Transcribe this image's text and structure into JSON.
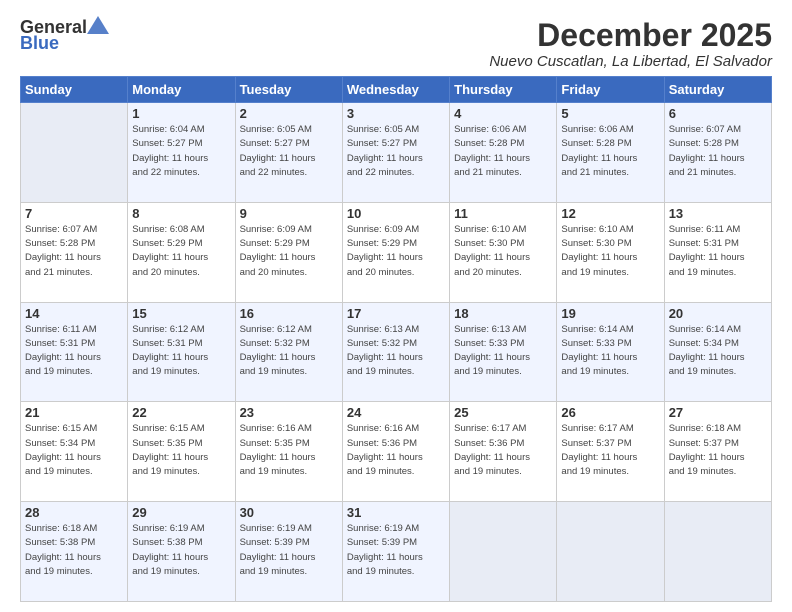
{
  "header": {
    "logo_general": "General",
    "logo_blue": "Blue",
    "month_title": "December 2025",
    "location": "Nuevo Cuscatlan, La Libertad, El Salvador"
  },
  "weekdays": [
    "Sunday",
    "Monday",
    "Tuesday",
    "Wednesday",
    "Thursday",
    "Friday",
    "Saturday"
  ],
  "weeks": [
    [
      {
        "day": "",
        "info": ""
      },
      {
        "day": "1",
        "info": "Sunrise: 6:04 AM\nSunset: 5:27 PM\nDaylight: 11 hours\nand 22 minutes."
      },
      {
        "day": "2",
        "info": "Sunrise: 6:05 AM\nSunset: 5:27 PM\nDaylight: 11 hours\nand 22 minutes."
      },
      {
        "day": "3",
        "info": "Sunrise: 6:05 AM\nSunset: 5:27 PM\nDaylight: 11 hours\nand 22 minutes."
      },
      {
        "day": "4",
        "info": "Sunrise: 6:06 AM\nSunset: 5:28 PM\nDaylight: 11 hours\nand 21 minutes."
      },
      {
        "day": "5",
        "info": "Sunrise: 6:06 AM\nSunset: 5:28 PM\nDaylight: 11 hours\nand 21 minutes."
      },
      {
        "day": "6",
        "info": "Sunrise: 6:07 AM\nSunset: 5:28 PM\nDaylight: 11 hours\nand 21 minutes."
      }
    ],
    [
      {
        "day": "7",
        "info": "Sunrise: 6:07 AM\nSunset: 5:28 PM\nDaylight: 11 hours\nand 21 minutes."
      },
      {
        "day": "8",
        "info": "Sunrise: 6:08 AM\nSunset: 5:29 PM\nDaylight: 11 hours\nand 20 minutes."
      },
      {
        "day": "9",
        "info": "Sunrise: 6:09 AM\nSunset: 5:29 PM\nDaylight: 11 hours\nand 20 minutes."
      },
      {
        "day": "10",
        "info": "Sunrise: 6:09 AM\nSunset: 5:29 PM\nDaylight: 11 hours\nand 20 minutes."
      },
      {
        "day": "11",
        "info": "Sunrise: 6:10 AM\nSunset: 5:30 PM\nDaylight: 11 hours\nand 20 minutes."
      },
      {
        "day": "12",
        "info": "Sunrise: 6:10 AM\nSunset: 5:30 PM\nDaylight: 11 hours\nand 19 minutes."
      },
      {
        "day": "13",
        "info": "Sunrise: 6:11 AM\nSunset: 5:31 PM\nDaylight: 11 hours\nand 19 minutes."
      }
    ],
    [
      {
        "day": "14",
        "info": "Sunrise: 6:11 AM\nSunset: 5:31 PM\nDaylight: 11 hours\nand 19 minutes."
      },
      {
        "day": "15",
        "info": "Sunrise: 6:12 AM\nSunset: 5:31 PM\nDaylight: 11 hours\nand 19 minutes."
      },
      {
        "day": "16",
        "info": "Sunrise: 6:12 AM\nSunset: 5:32 PM\nDaylight: 11 hours\nand 19 minutes."
      },
      {
        "day": "17",
        "info": "Sunrise: 6:13 AM\nSunset: 5:32 PM\nDaylight: 11 hours\nand 19 minutes."
      },
      {
        "day": "18",
        "info": "Sunrise: 6:13 AM\nSunset: 5:33 PM\nDaylight: 11 hours\nand 19 minutes."
      },
      {
        "day": "19",
        "info": "Sunrise: 6:14 AM\nSunset: 5:33 PM\nDaylight: 11 hours\nand 19 minutes."
      },
      {
        "day": "20",
        "info": "Sunrise: 6:14 AM\nSunset: 5:34 PM\nDaylight: 11 hours\nand 19 minutes."
      }
    ],
    [
      {
        "day": "21",
        "info": "Sunrise: 6:15 AM\nSunset: 5:34 PM\nDaylight: 11 hours\nand 19 minutes."
      },
      {
        "day": "22",
        "info": "Sunrise: 6:15 AM\nSunset: 5:35 PM\nDaylight: 11 hours\nand 19 minutes."
      },
      {
        "day": "23",
        "info": "Sunrise: 6:16 AM\nSunset: 5:35 PM\nDaylight: 11 hours\nand 19 minutes."
      },
      {
        "day": "24",
        "info": "Sunrise: 6:16 AM\nSunset: 5:36 PM\nDaylight: 11 hours\nand 19 minutes."
      },
      {
        "day": "25",
        "info": "Sunrise: 6:17 AM\nSunset: 5:36 PM\nDaylight: 11 hours\nand 19 minutes."
      },
      {
        "day": "26",
        "info": "Sunrise: 6:17 AM\nSunset: 5:37 PM\nDaylight: 11 hours\nand 19 minutes."
      },
      {
        "day": "27",
        "info": "Sunrise: 6:18 AM\nSunset: 5:37 PM\nDaylight: 11 hours\nand 19 minutes."
      }
    ],
    [
      {
        "day": "28",
        "info": "Sunrise: 6:18 AM\nSunset: 5:38 PM\nDaylight: 11 hours\nand 19 minutes."
      },
      {
        "day": "29",
        "info": "Sunrise: 6:19 AM\nSunset: 5:38 PM\nDaylight: 11 hours\nand 19 minutes."
      },
      {
        "day": "30",
        "info": "Sunrise: 6:19 AM\nSunset: 5:39 PM\nDaylight: 11 hours\nand 19 minutes."
      },
      {
        "day": "31",
        "info": "Sunrise: 6:19 AM\nSunset: 5:39 PM\nDaylight: 11 hours\nand 19 minutes."
      },
      {
        "day": "",
        "info": ""
      },
      {
        "day": "",
        "info": ""
      },
      {
        "day": "",
        "info": ""
      }
    ]
  ]
}
